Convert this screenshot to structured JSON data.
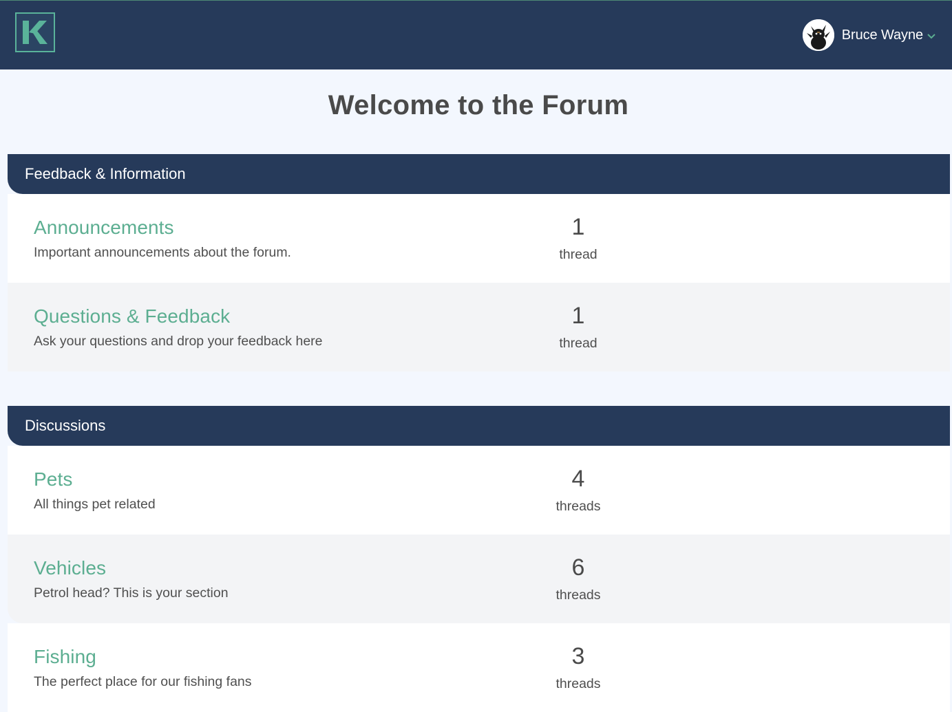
{
  "header": {
    "logo_letter": "K",
    "user_name": "Bruce Wayne",
    "icons": {
      "logo": "k-logo-icon",
      "avatar": "user-avatar",
      "dropdown": "chevron-down-icon"
    },
    "colors": {
      "navbar": "#263a5a",
      "accent": "#5cae91",
      "logo_border": "#5ab39a"
    }
  },
  "page": {
    "title": "Welcome to the Forum"
  },
  "categories": [
    {
      "title": "Feedback & Information",
      "forums": [
        {
          "name": "Announcements",
          "description": "Important announcements about the forum.",
          "count": "1",
          "unit": "thread"
        },
        {
          "name": "Questions & Feedback",
          "description": "Ask your questions and drop your feedback here",
          "count": "1",
          "unit": "thread"
        }
      ]
    },
    {
      "title": "Discussions",
      "forums": [
        {
          "name": "Pets",
          "description": "All things pet related",
          "count": "4",
          "unit": "threads"
        },
        {
          "name": "Vehicles",
          "description": "Petrol head? This is your section",
          "count": "6",
          "unit": "threads"
        },
        {
          "name": "Fishing",
          "description": "The perfect place for our fishing fans",
          "count": "3",
          "unit": "threads"
        }
      ]
    }
  ]
}
